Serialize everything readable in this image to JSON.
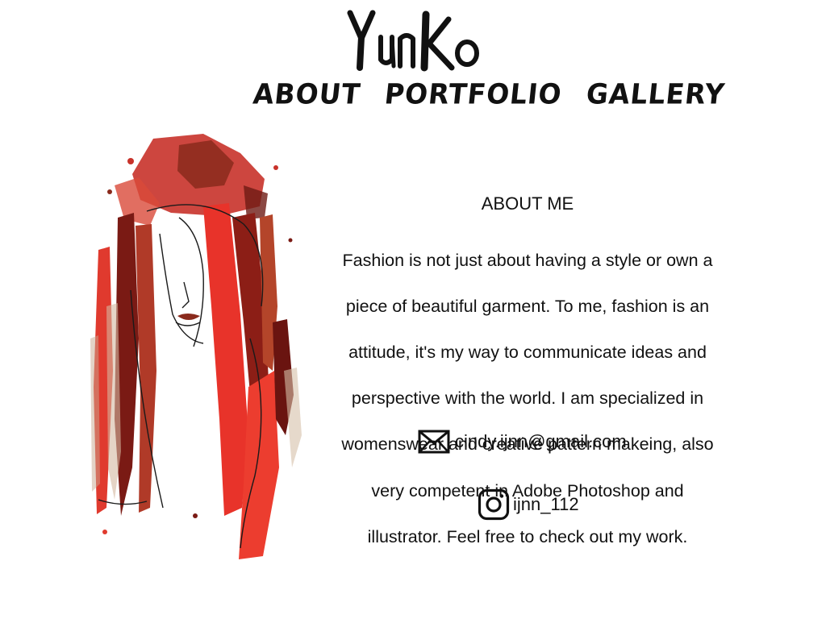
{
  "brand": {
    "logo_text": "YunKo"
  },
  "nav": {
    "items": [
      {
        "label": "About"
      },
      {
        "label": "Portfolio"
      },
      {
        "label": "Gallery"
      }
    ]
  },
  "about": {
    "heading": "ABOUT ME",
    "body_lines": [
      "Fashion is not just about having a style or own a",
      "piece of beautiful garment.  To me, fashion is an",
      "attitude, it's my way to communicate ideas and",
      "perspective with the world.  I am specialized in",
      "womenswear and creative pattern makeing, also",
      "very competent in  Adobe Photoshop and",
      "illustrator. Feel free to check out my work."
    ]
  },
  "contact": {
    "email": "cindy.ijnn@gmail.com",
    "email_icon": "mail-icon",
    "instagram": "ijnn_112",
    "instagram_icon": "instagram-icon"
  },
  "colors": {
    "text": "#111111",
    "accent_red": "#e8332a",
    "dark_red": "#7a1a14",
    "rust": "#b4452a",
    "background": "#ffffff"
  }
}
